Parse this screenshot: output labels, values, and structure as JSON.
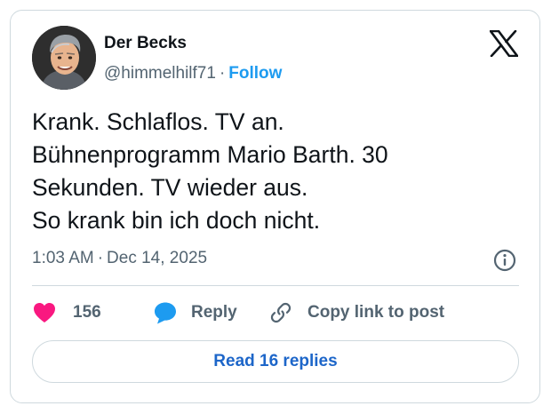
{
  "tweet": {
    "author_name": "Der Becks",
    "handle": "@himmelhilf71",
    "separator": "·",
    "follow_label": "Follow",
    "text_lines": [
      "Krank. Schlaflos. TV an.",
      "Bühnenprogramm Mario Barth. 30",
      "Sekunden. TV wieder aus.",
      "So krank bin ich doch nicht."
    ],
    "time": "1:03 AM",
    "date": "Dec 14, 2025"
  },
  "actions": {
    "like_count": "156",
    "reply_label": "Reply",
    "copy_link_label": "Copy link to post"
  },
  "read_replies_label": "Read 16 replies",
  "icons": {
    "brand": "x-logo-icon",
    "info": "info-icon",
    "like": "heart-icon",
    "reply": "speech-bubble-icon",
    "copy": "link-icon"
  },
  "colors": {
    "accent": "#1d9bf0",
    "like": "#f91880",
    "text": "#0f1419",
    "muted": "#536471",
    "border": "#cfd9de"
  }
}
